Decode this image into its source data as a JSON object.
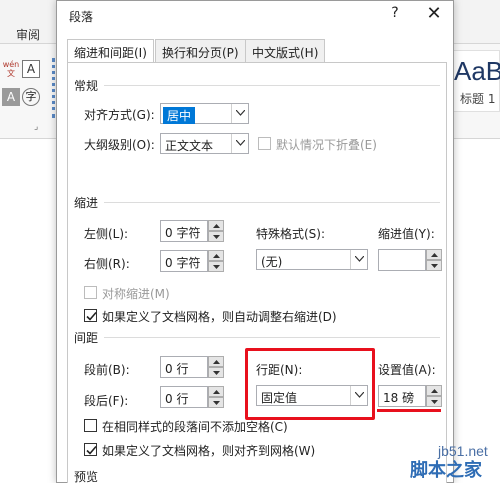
{
  "app": {
    "ribbon_tab": "审阅",
    "ribbon_btn_a": "A",
    "ribbon_btn_phonetic": "wén\n文",
    "ribbon_btn_shade": "A",
    "ribbon_btn_circle": "字",
    "style_sample": "AaB",
    "style_name": "标题 1"
  },
  "dialog": {
    "title": "段落",
    "help_label": "?",
    "close_label": "✕",
    "tabs": [
      {
        "label": "缩进和间距(I)",
        "active": true
      },
      {
        "label": "换行和分页(P)",
        "active": false
      },
      {
        "label": "中文版式(H)",
        "active": false
      }
    ],
    "general": {
      "section_title": "常规",
      "alignment_label": "对齐方式(G):",
      "alignment_value": "居中",
      "outline_label": "大纲级别(O):",
      "outline_value": "正文文本",
      "collapsed_label": "默认情况下折叠(E)"
    },
    "indent": {
      "section_title": "缩进",
      "left_label": "左侧(L):",
      "left_value": "0 字符",
      "right_label": "右侧(R):",
      "right_value": "0 字符",
      "special_label": "特殊格式(S):",
      "special_value": "(无)",
      "by_label": "缩进值(Y):",
      "by_value": "",
      "mirror_label": "对称缩进(M)",
      "auto_adjust_label": "如果定义了文档网格，则自动调整右缩进(D)"
    },
    "spacing": {
      "section_title": "间距",
      "before_label": "段前(B):",
      "before_value": "0 行",
      "after_label": "段后(F):",
      "after_value": "0 行",
      "line_spacing_label": "行距(N):",
      "line_spacing_value": "固定值",
      "at_label": "设置值(A):",
      "at_value": "18 磅",
      "no_space_label": "在相同样式的段落间不添加空格(C)",
      "snap_grid_label": "如果定义了文档网格，则对齐到网格(W)"
    },
    "preview": {
      "section_title": "预览"
    }
  },
  "watermark": {
    "url": "jb51.net",
    "name": "脚本之家"
  },
  "colors": {
    "highlight_red": "#e8101d",
    "selection_blue": "#0078d7"
  }
}
